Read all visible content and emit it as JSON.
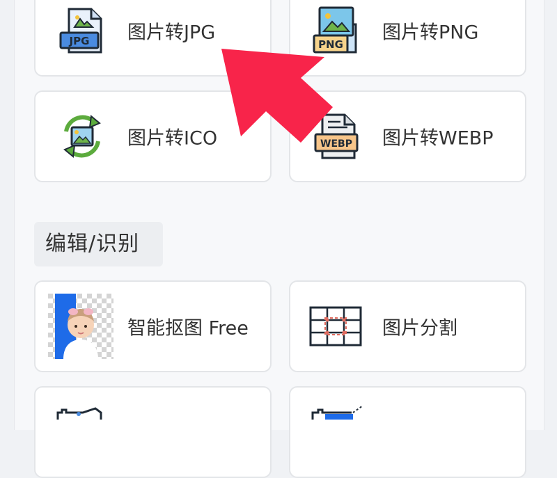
{
  "colors": {
    "arrow": "#f8244a",
    "card_border": "#e3e5e8",
    "text": "#333333",
    "section_bg": "#eceef1"
  },
  "convert_cards": [
    {
      "label": "图片转JPG",
      "icon": "jpg-file-icon",
      "badge": "JPG"
    },
    {
      "label": "图片转PNG",
      "icon": "png-file-icon",
      "badge": "PNG"
    },
    {
      "label": "图片转ICO",
      "icon": "image-convert-cycle-icon"
    },
    {
      "label": "图片转WEBP",
      "icon": "webp-file-icon",
      "badge": "WEBP"
    }
  ],
  "section": {
    "title": "编辑/识别"
  },
  "edit_cards": [
    {
      "label": "智能抠图 Free",
      "icon": "smart-cutout-thumbnail"
    },
    {
      "label": "图片分割",
      "icon": "grid-split-icon"
    }
  ],
  "annotation": {
    "icon": "red-pointer-arrow"
  }
}
